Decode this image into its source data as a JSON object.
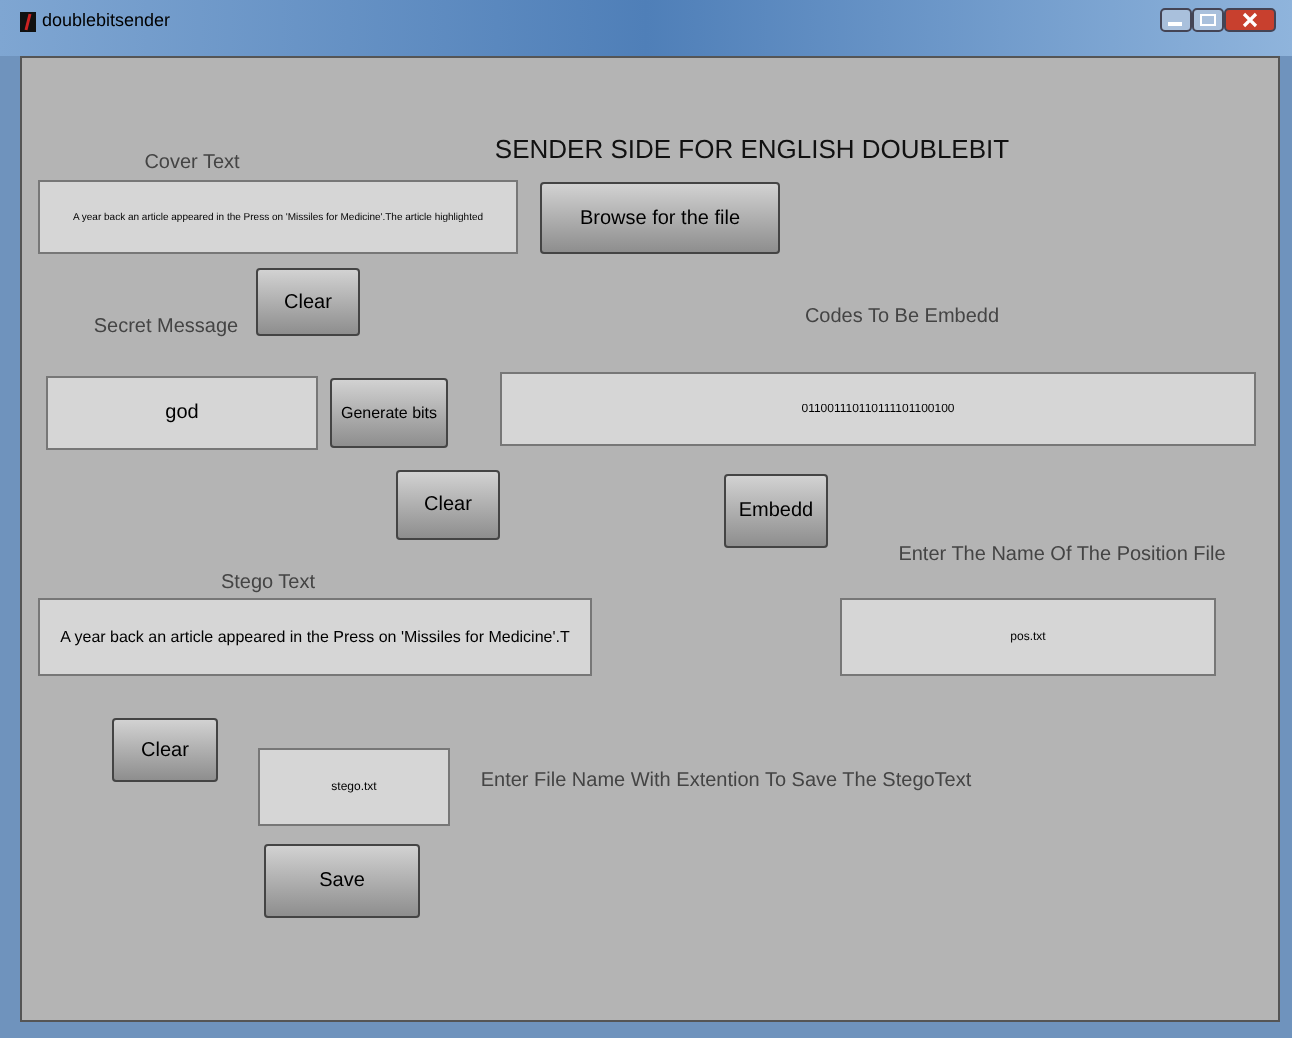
{
  "window": {
    "title": "doublebitsender"
  },
  "controls": [
    {
      "kind": "heading",
      "text": "SENDER SIDE FOR ENGLISH DOUBLEBIT"
    },
    {
      "kind": "label",
      "text": "Cover Text"
    },
    {
      "kind": "field",
      "text": "A year back an article appeared in the Press on 'Missiles for Medicine'.The article highlighted"
    },
    {
      "kind": "button",
      "text": "Browse for the file"
    },
    {
      "kind": "button",
      "text": "Clear"
    },
    {
      "kind": "label",
      "text": "Secret Message"
    },
    {
      "kind": "label",
      "text": "Codes To Be Embedd"
    },
    {
      "kind": "field",
      "text": "god"
    },
    {
      "kind": "button",
      "text": "Generate bits"
    },
    {
      "kind": "field",
      "text": "011001110110111101100100"
    },
    {
      "kind": "button",
      "text": "Clear"
    },
    {
      "kind": "button",
      "text": "Embedd"
    },
    {
      "kind": "label",
      "text": "Enter The Name Of The Position File"
    },
    {
      "kind": "label",
      "text": "Stego Text"
    },
    {
      "kind": "field",
      "text": "A year back an article appeared in the Press on 'Missiles for Medicine'.T"
    },
    {
      "kind": "field",
      "text": "pos.txt"
    },
    {
      "kind": "button",
      "text": "Clear"
    },
    {
      "kind": "field",
      "text": "stego.txt"
    },
    {
      "kind": "label",
      "text": "Enter File Name With Extention To Save The StegoText"
    },
    {
      "kind": "button",
      "text": "Save"
    }
  ]
}
